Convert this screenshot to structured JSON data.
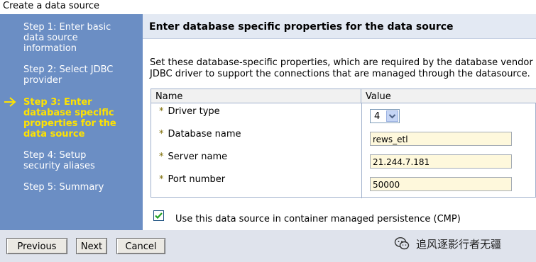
{
  "window": {
    "title": "Create a data source"
  },
  "wizard": {
    "steps": [
      {
        "lines": [
          "Step 1: Enter basic",
          "data source",
          "information"
        ],
        "current": false
      },
      {
        "lines": [
          "Step 2: Select JDBC",
          "provider"
        ],
        "current": false
      },
      {
        "lines": [
          "Step 3: Enter",
          "database specific",
          "properties for the",
          "data source"
        ],
        "current": true
      },
      {
        "lines": [
          "Step 4: Setup",
          "security aliases"
        ],
        "current": false
      },
      {
        "lines": [
          "Step 5: Summary"
        ],
        "current": false
      }
    ],
    "current_step_icon": "arrow-right-icon"
  },
  "content": {
    "header": "Enter database specific properties for the data source",
    "description_line1": "Set these database-specific properties, which are required by the database vendor",
    "description_line2": "JDBC driver to support the connections that are managed through the datasource."
  },
  "table": {
    "headers": {
      "name": "Name",
      "value": "Value"
    },
    "required_marker": "*",
    "rows": {
      "driver_type": {
        "label": "Driver type",
        "value": "4"
      },
      "database_name": {
        "label": "Database name",
        "value": "rews_etl"
      },
      "server_name": {
        "label": "Server name",
        "value": "21.244.7.181"
      },
      "port_number": {
        "label": "Port number",
        "value": "50000"
      }
    }
  },
  "cmp": {
    "checked": true,
    "label": "Use this data source in container managed persistence (CMP)"
  },
  "footer": {
    "previous": "Previous",
    "next": "Next",
    "cancel": "Cancel"
  },
  "watermark": {
    "text": "追风逐影行者无疆",
    "icon": "wechat-logo-icon"
  },
  "colors": {
    "sidebar_bg": "#6b8ec4",
    "current_step": "#ffe300",
    "input_bg": "#fef8dc",
    "header_bg": "#e3e9f3"
  }
}
